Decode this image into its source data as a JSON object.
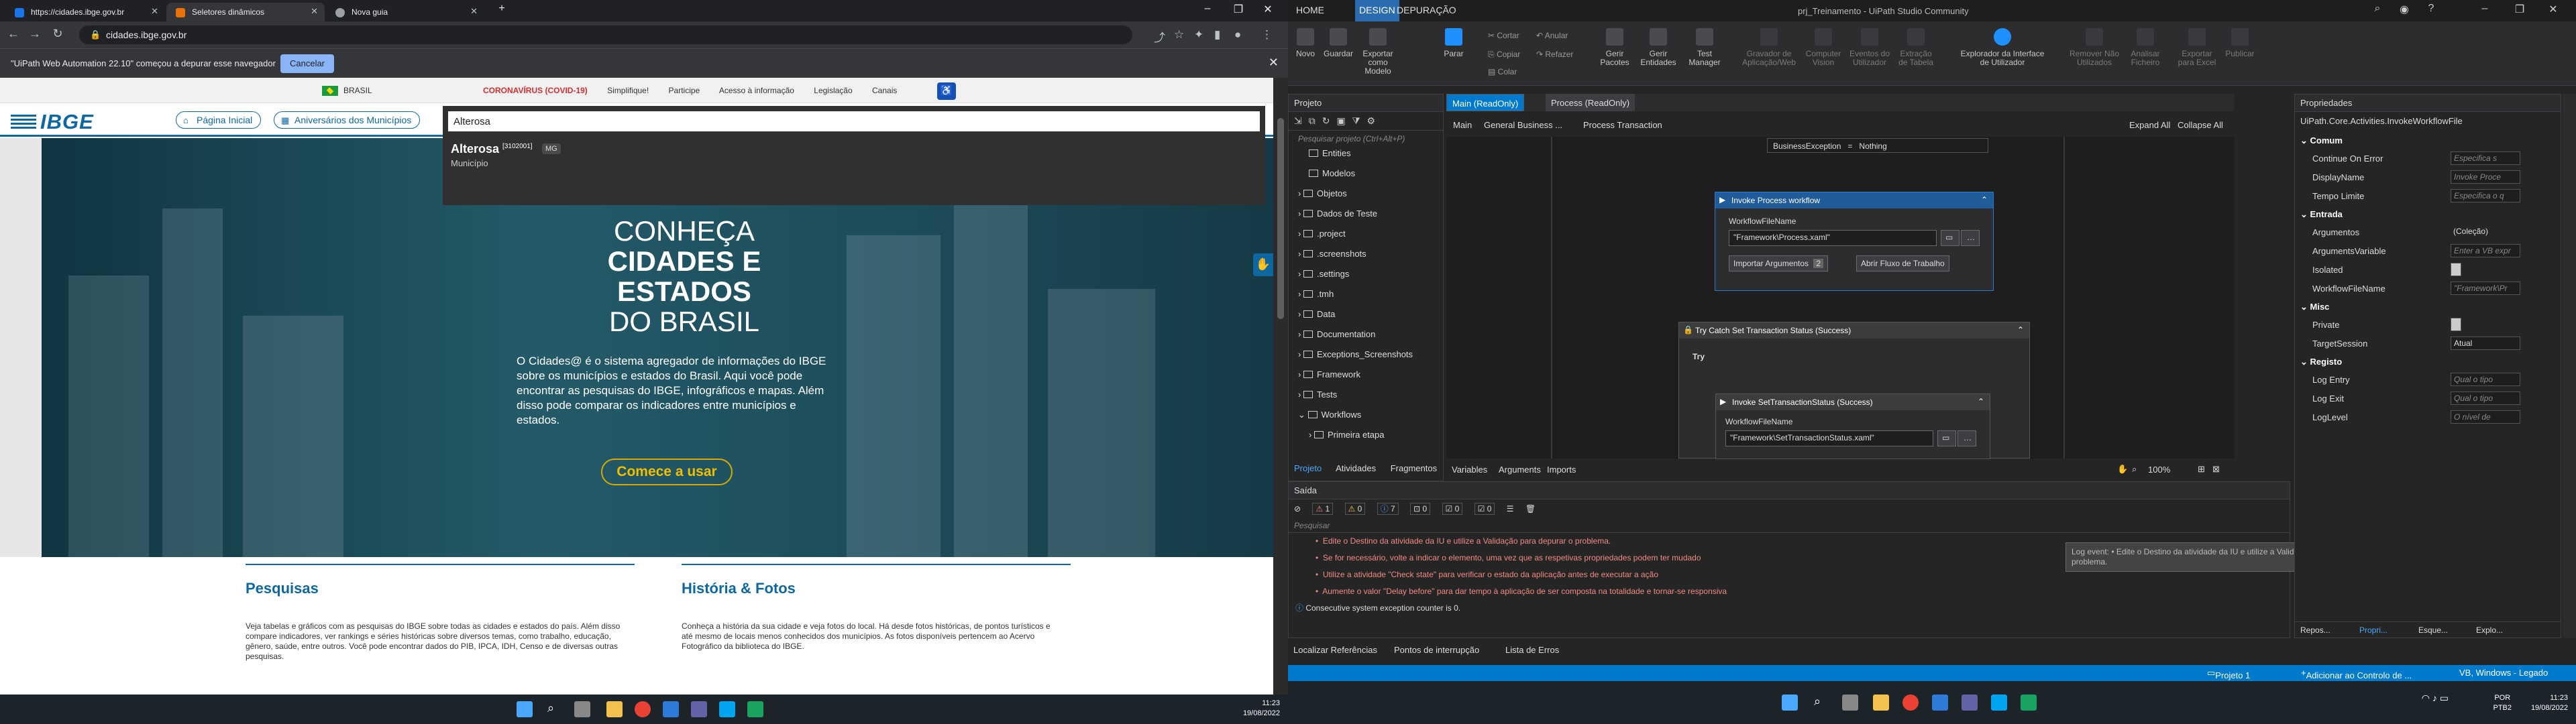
{
  "browser": {
    "tabs": [
      {
        "label": "https://cidades.ibge.gov.br",
        "color": "#1a73e8"
      },
      {
        "label": "Seletores dinâmicos",
        "color": "#e8710a"
      },
      {
        "label": "Nova guia",
        "color": "#9aa0a6"
      }
    ],
    "url": "cidades.ibge.gov.br",
    "infobar_text": "\"UiPath Web Automation 22.10\" começou a depurar esse navegador",
    "infobar_cancel": "Cancelar"
  },
  "govbar": {
    "brasil": "BRASIL",
    "links": [
      "CORONAVÍRUS (COVID-19)",
      "Simplifique!",
      "Participe",
      "Acesso à informação",
      "Legislação",
      "Canais"
    ]
  },
  "site": {
    "logo": "IBGE",
    "nav": [
      "Página Inicial",
      "Aniversários dos Municípios"
    ],
    "search_value": "Alterosa",
    "result_name": "Alterosa",
    "result_code": "[3102001]",
    "result_uf": "MG",
    "result_type": "Município",
    "hero_line1": "CONHEÇA",
    "hero_line2": "CIDADES E",
    "hero_line3": "ESTADOS",
    "hero_line4": "DO BRASIL",
    "hero_desc": "O Cidades@ é o sistema agregador de informações do IBGE sobre os municípios e estados do Brasil. Aqui você pode encontrar as pesquisas do IBGE, infográficos e mapas. Além disso pode comparar os indicadores entre municípios e estados.",
    "cta": "Comece a usar",
    "sections": [
      {
        "title": "Pesquisas",
        "text": "Veja tabelas e gráficos com as pesquisas do IBGE sobre todas as cidades e estados do país. Além disso compare indicadores, ver rankings e séries históricas sobre diversos temas, como trabalho, educação, gênero, saúde, entre outros. Você pode encontrar dados do PIB, IPCA, IDH, Censo e de diversas outras pesquisas."
      },
      {
        "title": "História & Fotos",
        "text": "Conheça a história da sua cidade e veja fotos do local. Há desde fotos históricas, de pontos turísticos e até mesmo de locais menos conhecidos dos municípios. As fotos disponíveis pertencem ao Acervo Fotográfico da biblioteca do IBGE."
      }
    ]
  },
  "taskbar1": {
    "time": "11:23",
    "date": "19/08/2022"
  },
  "uipath": {
    "menu": [
      "HOME",
      "DESIGN",
      "DEPURAÇÃO"
    ],
    "title": "prj_Treinamento - UiPath Studio Community",
    "ribbon": [
      {
        "label": "Novo",
        "dim": false
      },
      {
        "label": "Guardar",
        "dim": false
      },
      {
        "label": "Exportar como Modelo",
        "dim": false
      },
      {
        "label": "Parar",
        "dim": false
      },
      {
        "label": "Gerir Pacotes",
        "dim": false
      },
      {
        "label": "Gerir Entidades",
        "dim": false
      },
      {
        "label": "Test Manager",
        "dim": false
      },
      {
        "label": "Gravador de Aplicação/Web",
        "dim": true
      },
      {
        "label": "Computer Vision",
        "dim": true
      },
      {
        "label": "Eventos do Utilizador",
        "dim": true
      },
      {
        "label": "Extração de Tabela",
        "dim": true
      },
      {
        "label": "Explorador da Interface de Utilizador",
        "dim": false
      },
      {
        "label": "Remover Não Utilizados",
        "dim": true
      },
      {
        "label": "Analisar Ficheiro",
        "dim": true
      },
      {
        "label": "Exportar para Excel",
        "dim": true
      },
      {
        "label": "Publicar",
        "dim": true
      }
    ],
    "ribbon_small": [
      "Cortar",
      "Copiar",
      "Colar",
      "Anular",
      "Refazer"
    ],
    "project_title": "Projeto",
    "project_search": "Pesquisar projeto (Ctrl+Alt+P)",
    "tree": [
      "Entities",
      "Modelos",
      "Objetos",
      "Dados de Teste",
      ".project",
      ".screenshots",
      ".settings",
      ".tmh",
      "Data",
      "Documentation",
      "Exceptions_Screenshots",
      "Framework",
      "Tests",
      "Workflows",
      "Primeira etapa"
    ],
    "project_tabs": [
      "Projeto",
      "Atividades",
      "Fragmentos"
    ],
    "doc_tabs": [
      "Main (ReadOnly)",
      "Process (ReadOnly)"
    ],
    "breadcrumb": [
      "Main",
      "General Business ...",
      "Process Transaction"
    ],
    "expand_all": "Expand All",
    "collapse_all": "Collapse All",
    "be_label": "BusinessException",
    "be_value": "Nothing",
    "invoke1_title": "Invoke Process workflow",
    "wf_label": "WorkflowFileName",
    "invoke1_file": "\"Framework\\Process.xaml\"",
    "import_args": "Importar Argumentos",
    "import_count": "2",
    "open_wf": "Abrir Fluxo de Trabalho",
    "try_catch": "Try Catch Set Transaction Status (Success)",
    "try_label": "Try",
    "invoke2_title": "Invoke SetTransactionStatus (Success)",
    "invoke2_file": "\"Framework\\SetTransactionStatus.xaml\"",
    "canvas_tabs": [
      "Variables",
      "Arguments",
      "Imports"
    ],
    "zoom": "100%",
    "output_title": "Saída",
    "output_counts": [
      "1",
      "0",
      "7",
      "0",
      "0",
      "0"
    ],
    "output_search": "Pesquisar",
    "output_lines": [
      "Edite o Destino da atividade da IU e utilize a Validação para depurar o problema.",
      "Se for necessário, volte a indicar o elemento, uma vez que as respetivas propriedades podem ter mudado",
      "Utilize a atividade \"Check state\" para verificar o estado da aplicação antes de executar a ação",
      "Aumente o valor \"Delay before\" para dar tempo à aplicação de ser composta na totalidade e tornar-se responsiva",
      "Consecutive system exception counter is 0."
    ],
    "tooltip": "Log event: • Edite o Destino da atividade da IU e utilize a Validação para depurar o problema.",
    "bottom_tabs": [
      "Localizar Referências",
      "Pontos de interrupção",
      "Lista de Erros"
    ],
    "props_title": "Propriedades",
    "props_type": "UiPath.Core.Activities.InvokeWorkflowFile",
    "props": [
      {
        "section": "Comum"
      },
      {
        "name": "Continue On Error",
        "value": "Especifica s"
      },
      {
        "name": "DisplayName",
        "value": "Invoke Proce"
      },
      {
        "name": "Tempo Limite",
        "value": "Especifica o q"
      },
      {
        "section": "Entrada"
      },
      {
        "name": "Argumentos",
        "value": "(Coleção)"
      },
      {
        "name": "ArgumentsVariable",
        "value": "Enter a VB expr"
      },
      {
        "name": "Isolated",
        "value": ""
      },
      {
        "name": "WorkflowFileName",
        "value": "\"Framework\\Pr"
      },
      {
        "section": "Misc"
      },
      {
        "name": "Private",
        "value": ""
      },
      {
        "name": "TargetSession",
        "value": "Atual"
      },
      {
        "section": "Registo"
      },
      {
        "name": "Log Entry",
        "value": "Qual o tipo"
      },
      {
        "name": "Log Exit",
        "value": "Qual o tipo"
      },
      {
        "name": "LogLevel",
        "value": "O nível de"
      }
    ],
    "right_tabs": [
      "Repos...",
      "Propri...",
      "Esque...",
      "Explo..."
    ],
    "status_project": "Projeto 1",
    "status_source": "Adicionar ao Controlo de ...",
    "status_env": "VB, Windows - Legado"
  },
  "taskbar2": {
    "lang": "POR",
    "layout": "PTB2",
    "time": "11:23",
    "date": "19/08/2022"
  }
}
